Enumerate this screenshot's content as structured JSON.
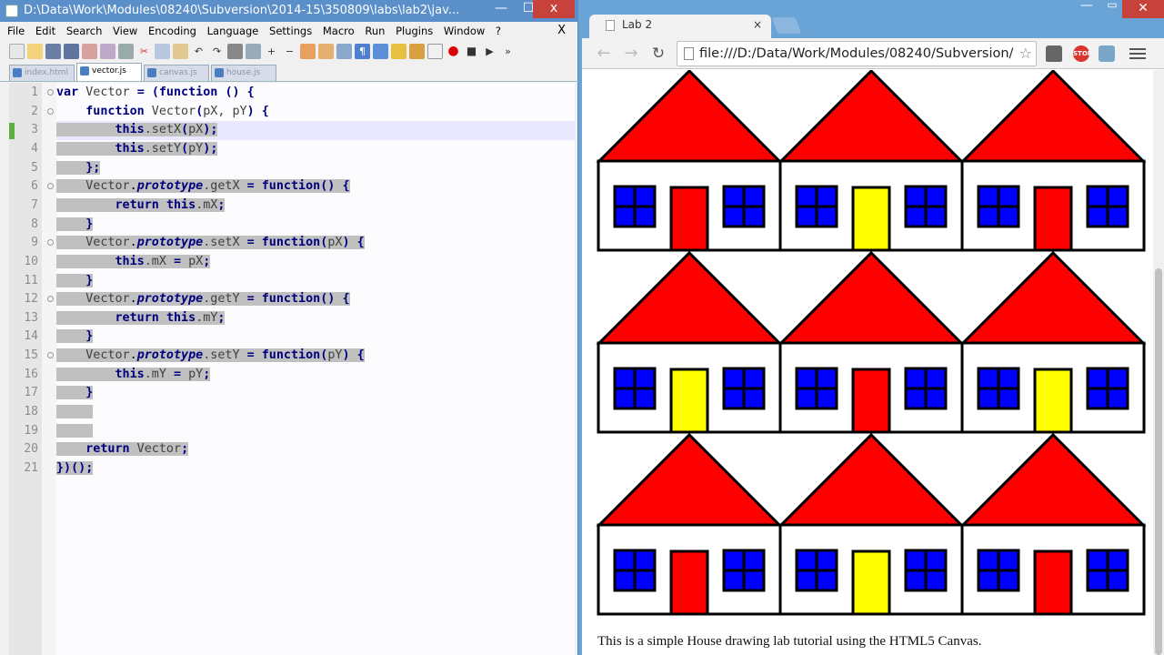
{
  "npp": {
    "title": "D:\\Data\\Work\\Modules\\08240\\Subversion\\2014-15\\350809\\labs\\lab2\\jav...",
    "close_glyph": "x",
    "menu": [
      "File",
      "Edit",
      "Search",
      "View",
      "Encoding",
      "Language",
      "Settings",
      "Macro",
      "Run",
      "Plugins",
      "Window",
      "?"
    ],
    "menu_close": "X",
    "tabs": [
      "index.html",
      "vector.js",
      "canvas.js",
      "house.js"
    ],
    "active_tab": 1,
    "line_numbers": [
      "1",
      "2",
      "3",
      "4",
      "5",
      "6",
      "7",
      "8",
      "9",
      "10",
      "11",
      "12",
      "13",
      "14",
      "15",
      "16",
      "17",
      "18",
      "19",
      "20",
      "21"
    ],
    "code": {
      "l1": [
        "var",
        " Vector ",
        "=",
        " ",
        "(",
        "function",
        " ",
        "()",
        " ",
        "{"
      ],
      "l2": [
        "function",
        " Vector",
        "(",
        "pX, pY",
        ")",
        " ",
        "{"
      ],
      "l3": [
        "this",
        ".setX",
        "(",
        "pX",
        ")",
        ";"
      ],
      "l4": [
        "this",
        ".setY",
        "(",
        "pY",
        ")",
        ";"
      ],
      "l5": [
        "};"
      ],
      "l6": [
        "Vector",
        ".",
        "prototype",
        ".getX ",
        "=",
        " ",
        "function",
        "()",
        " ",
        "{"
      ],
      "l7": [
        "return",
        " ",
        "this",
        ".mX",
        ";"
      ],
      "l8": [
        "}"
      ],
      "l9": [
        "Vector",
        ".",
        "prototype",
        ".setX ",
        "=",
        " ",
        "function",
        "(",
        "pX",
        ")",
        " ",
        "{"
      ],
      "l10": [
        "this",
        ".mX ",
        "=",
        " pX",
        ";"
      ],
      "l11": [
        "}"
      ],
      "l12": [
        "Vector",
        ".",
        "prototype",
        ".getY ",
        "=",
        " ",
        "function",
        "()",
        " ",
        "{"
      ],
      "l13": [
        "return",
        " ",
        "this",
        ".mY",
        ";"
      ],
      "l14": [
        "}"
      ],
      "l15": [
        "Vector",
        ".",
        "prototype",
        ".setY ",
        "=",
        " ",
        "function",
        "(",
        "pY",
        ")",
        " ",
        "{"
      ],
      "l16": [
        "this",
        ".mY ",
        "=",
        " pY",
        ";"
      ],
      "l17": [
        "}"
      ],
      "l20": [
        "return",
        " Vector",
        ";"
      ],
      "l21": [
        "})",
        "()",
        ";"
      ]
    }
  },
  "chrome": {
    "tab_title": "Lab 2",
    "tab_close": "×",
    "address": "file:///D:/Data/Work/Modules/08240/Subversion/",
    "ext_stop_label": "STOP",
    "page_text": "This is a simple House drawing lab tutorial using the HTML5 Canvas.",
    "house_door_colors": [
      [
        "#ff0000",
        "#ffff00",
        "#ff0000"
      ],
      [
        "#ffff00",
        "#ff0000",
        "#ffff00"
      ],
      [
        "#ff0000",
        "#ffff00",
        "#ff0000"
      ]
    ],
    "colors": {
      "roof": "#ff0000",
      "window": "#0000ff",
      "wall": "#ffffff",
      "outline": "#000000"
    }
  },
  "icons": {
    "back": "arrow-left-icon",
    "forward": "arrow-right-icon",
    "reload": "reload-icon",
    "star": "star-icon",
    "menu": "hamburger-menu-icon"
  }
}
